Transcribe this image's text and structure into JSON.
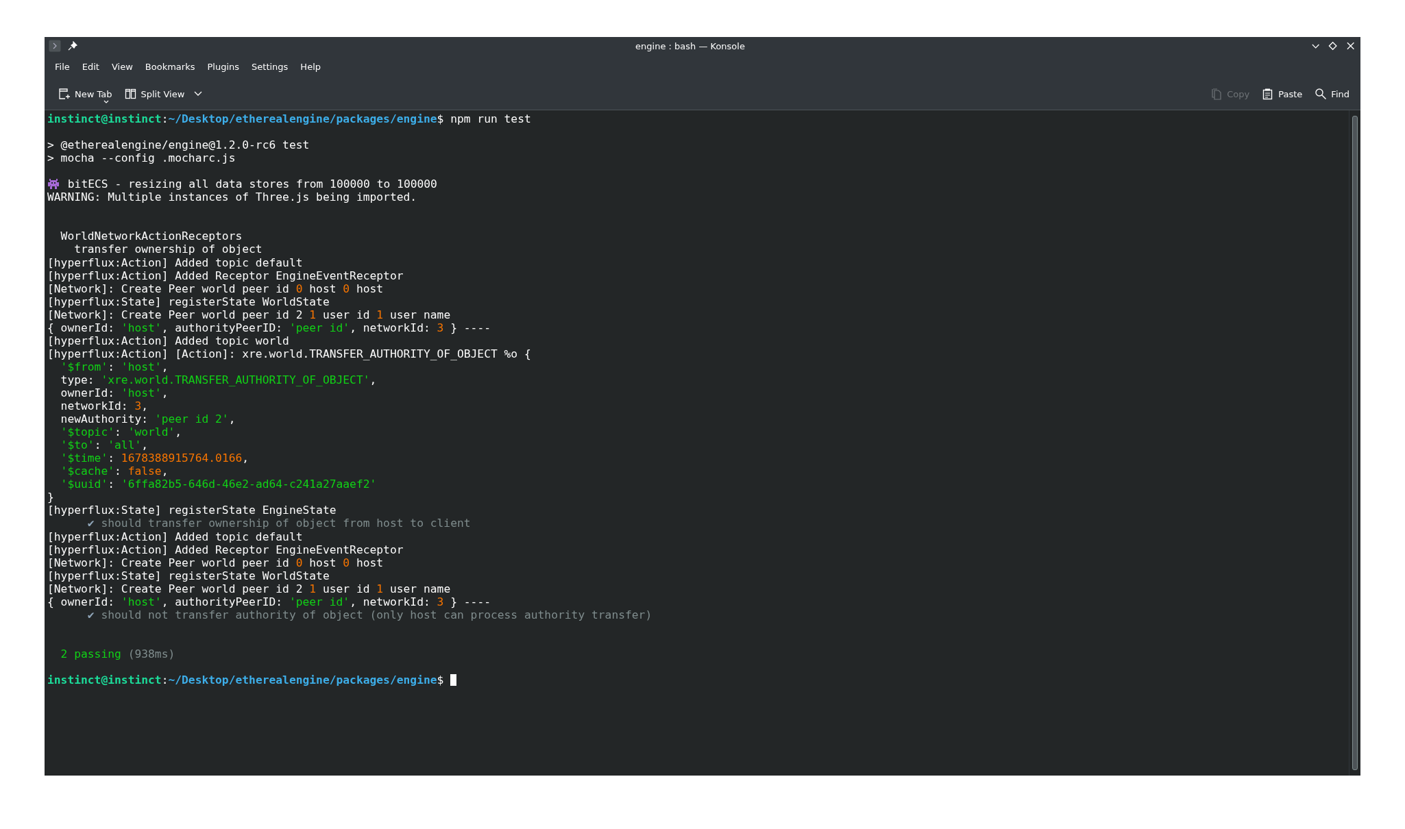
{
  "window": {
    "title": "engine : bash — Konsole"
  },
  "menu": [
    "File",
    "Edit",
    "View",
    "Bookmarks",
    "Plugins",
    "Settings",
    "Help"
  ],
  "toolbar": {
    "left": [
      {
        "label": "New Tab",
        "kind": "newtab",
        "disabled": false
      },
      {
        "label": "Split View",
        "kind": "split",
        "disabled": false
      }
    ],
    "right": [
      {
        "label": "Copy",
        "kind": "copy",
        "disabled": true
      },
      {
        "label": "Paste",
        "kind": "paste",
        "disabled": false
      },
      {
        "label": "Find",
        "kind": "find",
        "disabled": false
      }
    ]
  },
  "terminal": {
    "lines": [
      {
        "segments": [
          {
            "text": "instinct@instinct",
            "kind": "user"
          },
          {
            "text": ":",
            "kind": "text"
          },
          {
            "text": "~/Desktop/etherealengine/packages/engine",
            "kind": "path"
          },
          {
            "text": "$ npm run test",
            "kind": "text"
          }
        ]
      },
      {
        "kind": "blank"
      },
      {
        "segments": [
          {
            "text": "> @etherealengine/engine@1.2.0-rc6 test",
            "kind": "text"
          }
        ]
      },
      {
        "segments": [
          {
            "text": "> mocha --config .mocharc.js",
            "kind": "text"
          }
        ]
      },
      {
        "kind": "blank"
      },
      {
        "kind": "emoji",
        "segments": [
          {
            "text": " bitECS - resizing all data stores from 100000 to 100000",
            "kind": "text"
          }
        ]
      },
      {
        "segments": [
          {
            "text": "WARNING: Multiple instances of Three.js being imported.",
            "kind": "text"
          }
        ]
      },
      {
        "kind": "blank"
      },
      {
        "kind": "blank"
      },
      {
        "segments": [
          {
            "text": "  WorldNetworkActionReceptors",
            "kind": "text"
          }
        ]
      },
      {
        "segments": [
          {
            "text": "    transfer ownership of object",
            "kind": "text"
          }
        ]
      },
      {
        "segments": [
          {
            "text": "[hyperflux:Action] Added topic default",
            "kind": "text"
          }
        ]
      },
      {
        "segments": [
          {
            "text": "[hyperflux:Action] Added Receptor EngineEventReceptor",
            "kind": "text"
          }
        ]
      },
      {
        "segments": [
          {
            "text": "[Network]: Create Peer world peer id ",
            "kind": "text"
          },
          {
            "text": "0",
            "kind": "number"
          },
          {
            "text": " host ",
            "kind": "text"
          },
          {
            "text": "0",
            "kind": "number"
          },
          {
            "text": " host",
            "kind": "text"
          }
        ]
      },
      {
        "segments": [
          {
            "text": "[hyperflux:State] registerState WorldState",
            "kind": "text"
          }
        ]
      },
      {
        "segments": [
          {
            "text": "[Network]: Create Peer world peer id 2 ",
            "kind": "text"
          },
          {
            "text": "1",
            "kind": "number"
          },
          {
            "text": " user id ",
            "kind": "text"
          },
          {
            "text": "1",
            "kind": "number"
          },
          {
            "text": " user name",
            "kind": "text"
          }
        ]
      },
      {
        "segments": [
          {
            "text": "{ ownerId: ",
            "kind": "text"
          },
          {
            "text": "'host'",
            "kind": "string"
          },
          {
            "text": ", authorityPeerID: ",
            "kind": "text"
          },
          {
            "text": "'peer id'",
            "kind": "string"
          },
          {
            "text": ", networkId: ",
            "kind": "text"
          },
          {
            "text": "3",
            "kind": "number"
          },
          {
            "text": " } ----",
            "kind": "text"
          }
        ]
      },
      {
        "segments": [
          {
            "text": "[hyperflux:Action] Added topic world",
            "kind": "text"
          }
        ]
      },
      {
        "segments": [
          {
            "text": "[hyperflux:Action] [Action]: xre.world.TRANSFER_AUTHORITY_OF_OBJECT %o {",
            "kind": "text"
          }
        ]
      },
      {
        "segments": [
          {
            "text": "  '$from'",
            "kind": "string"
          },
          {
            "text": ": ",
            "kind": "text"
          },
          {
            "text": "'host'",
            "kind": "string"
          },
          {
            "text": ",",
            "kind": "text"
          }
        ]
      },
      {
        "segments": [
          {
            "text": "  type: ",
            "kind": "text"
          },
          {
            "text": "'xre.world.TRANSFER_AUTHORITY_OF_OBJECT'",
            "kind": "string"
          },
          {
            "text": ",",
            "kind": "text"
          }
        ]
      },
      {
        "segments": [
          {
            "text": "  ownerId: ",
            "kind": "text"
          },
          {
            "text": "'host'",
            "kind": "string"
          },
          {
            "text": ",",
            "kind": "text"
          }
        ]
      },
      {
        "segments": [
          {
            "text": "  networkId: ",
            "kind": "text"
          },
          {
            "text": "3",
            "kind": "number"
          },
          {
            "text": ",",
            "kind": "text"
          }
        ]
      },
      {
        "segments": [
          {
            "text": "  newAuthority: ",
            "kind": "text"
          },
          {
            "text": "'peer id 2'",
            "kind": "string"
          },
          {
            "text": ",",
            "kind": "text"
          }
        ]
      },
      {
        "segments": [
          {
            "text": "  '$topic'",
            "kind": "string"
          },
          {
            "text": ": ",
            "kind": "text"
          },
          {
            "text": "'world'",
            "kind": "string"
          },
          {
            "text": ",",
            "kind": "text"
          }
        ]
      },
      {
        "segments": [
          {
            "text": "  '$to'",
            "kind": "string"
          },
          {
            "text": ": ",
            "kind": "text"
          },
          {
            "text": "'all'",
            "kind": "string"
          },
          {
            "text": ",",
            "kind": "text"
          }
        ]
      },
      {
        "segments": [
          {
            "text": "  '$time'",
            "kind": "string"
          },
          {
            "text": ": ",
            "kind": "text"
          },
          {
            "text": "1678388915764.0166",
            "kind": "number"
          },
          {
            "text": ",",
            "kind": "text"
          }
        ]
      },
      {
        "segments": [
          {
            "text": "  '$cache'",
            "kind": "string"
          },
          {
            "text": ": ",
            "kind": "text"
          },
          {
            "text": "false",
            "kind": "number"
          },
          {
            "text": ",",
            "kind": "text"
          }
        ]
      },
      {
        "segments": [
          {
            "text": "  '$uuid'",
            "kind": "string"
          },
          {
            "text": ": ",
            "kind": "text"
          },
          {
            "text": "'6ffa82b5-646d-46e2-ad64-c241a27aaef2'",
            "kind": "string"
          }
        ]
      },
      {
        "segments": [
          {
            "text": "}",
            "kind": "text"
          }
        ]
      },
      {
        "segments": [
          {
            "text": "[hyperflux:State] registerState EngineState",
            "kind": "text"
          }
        ]
      },
      {
        "segments": [
          {
            "text": "      ✔",
            "kind": "check"
          },
          {
            "text": " should transfer ownership of object from host to client",
            "kind": "dim"
          }
        ]
      },
      {
        "segments": [
          {
            "text": "[hyperflux:Action] Added topic default",
            "kind": "text"
          }
        ]
      },
      {
        "segments": [
          {
            "text": "[hyperflux:Action] Added Receptor EngineEventReceptor",
            "kind": "text"
          }
        ]
      },
      {
        "segments": [
          {
            "text": "[Network]: Create Peer world peer id ",
            "kind": "text"
          },
          {
            "text": "0",
            "kind": "number"
          },
          {
            "text": " host ",
            "kind": "text"
          },
          {
            "text": "0",
            "kind": "number"
          },
          {
            "text": " host",
            "kind": "text"
          }
        ]
      },
      {
        "segments": [
          {
            "text": "[hyperflux:State] registerState WorldState",
            "kind": "text"
          }
        ]
      },
      {
        "segments": [
          {
            "text": "[Network]: Create Peer world peer id 2 ",
            "kind": "text"
          },
          {
            "text": "1",
            "kind": "number"
          },
          {
            "text": " user id ",
            "kind": "text"
          },
          {
            "text": "1",
            "kind": "number"
          },
          {
            "text": " user name",
            "kind": "text"
          }
        ]
      },
      {
        "segments": [
          {
            "text": "{ ownerId: ",
            "kind": "text"
          },
          {
            "text": "'host'",
            "kind": "string"
          },
          {
            "text": ", authorityPeerID: ",
            "kind": "text"
          },
          {
            "text": "'peer id'",
            "kind": "string"
          },
          {
            "text": ", networkId: ",
            "kind": "text"
          },
          {
            "text": "3",
            "kind": "number"
          },
          {
            "text": " } ----",
            "kind": "text"
          }
        ]
      },
      {
        "segments": [
          {
            "text": "      ✔",
            "kind": "check"
          },
          {
            "text": " should not transfer authority of object (only host can process authority transfer)",
            "kind": "dim"
          }
        ]
      },
      {
        "kind": "blank"
      },
      {
        "kind": "blank"
      },
      {
        "segments": [
          {
            "text": "  2 passing",
            "kind": "pass"
          },
          {
            "text": " (938ms)",
            "kind": "dim"
          }
        ]
      },
      {
        "kind": "blank"
      },
      {
        "kind": "prompt",
        "segments": [
          {
            "text": "instinct@instinct",
            "kind": "user"
          },
          {
            "text": ":",
            "kind": "text"
          },
          {
            "text": "~/Desktop/etherealengine/packages/engine",
            "kind": "path"
          },
          {
            "text": "$ ",
            "kind": "text"
          }
        ]
      }
    ]
  }
}
